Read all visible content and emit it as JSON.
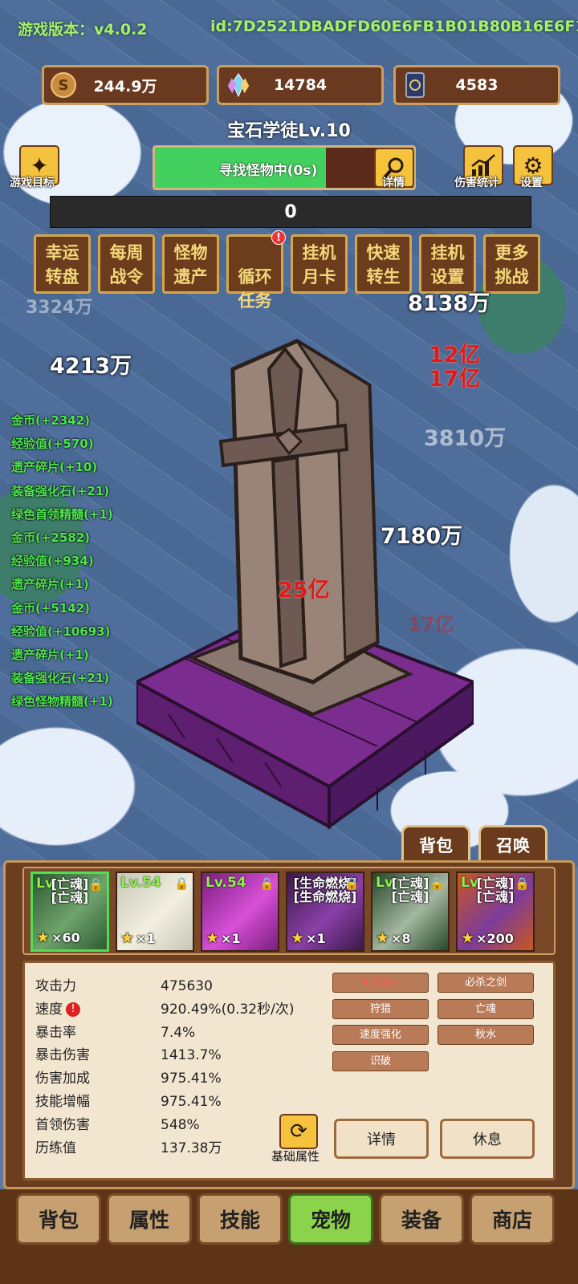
{
  "header": {
    "version_label": "游戏版本：v4.0.2",
    "player_id": "id:7D2521DBADFD60E6FB1B01B80B16E6F1"
  },
  "resources": [
    {
      "icon": "coin-icon",
      "value": "244.9万"
    },
    {
      "icon": "crystal-icon",
      "value": "14784"
    },
    {
      "icon": "card-icon",
      "value": "4583"
    }
  ],
  "player_title": "宝石学徒Lv.10",
  "search": {
    "status": "寻找怪物中(0s)",
    "progress": 0.66,
    "detail_label": "详情"
  },
  "left_tools": {
    "goals_label": "游戏目标"
  },
  "right_tools": {
    "damage_stats_label": "伤害统计",
    "settings_label": "设置"
  },
  "score_value": "0",
  "menu": [
    {
      "label": "幸运\n转盘",
      "badge": false
    },
    {
      "label": "每周\n战令",
      "badge": false
    },
    {
      "label": "怪物\n遗产",
      "badge": false
    },
    {
      "label": "循环\n任务",
      "badge": true
    },
    {
      "label": "挂机\n月卡",
      "badge": false
    },
    {
      "label": "快速\n转生",
      "badge": false
    },
    {
      "label": "挂机\n设置",
      "badge": false
    },
    {
      "label": "更多\n挑战",
      "badge": false
    }
  ],
  "damage_numbers": {
    "d1": "8138万",
    "d2": "4213万",
    "d3": "12亿",
    "d4": "17亿",
    "d5": "3810万",
    "d6": "7180万",
    "d7": "25亿",
    "d8": "17亿"
  },
  "loot_log": [
    "金币(+2342)",
    "经验值(+570)",
    "遗产碎片(+10)",
    "装备强化石(+21)",
    "绿色首领精髓(+1)",
    "金币(+2582)",
    "经验值(+934)",
    "遗产碎片(+1)",
    "金币(+5142)",
    "经验值(+10693)",
    "遗产碎片(+1)",
    "装备强化石(+21)",
    "绿色怪物精髓(+1)"
  ],
  "panel_tabs": {
    "bag": "背包",
    "summon": "召唤"
  },
  "pets": [
    {
      "lv": "Lv",
      "text": "[亡魂]\n[亡魂]",
      "count": "×60",
      "selected": true,
      "colors": [
        "#2e5a32",
        "#6ea36a"
      ]
    },
    {
      "lv": "Lv.54",
      "text": "",
      "count": "×1",
      "selected": false,
      "colors": [
        "#c7c7b8",
        "#f2efe0"
      ]
    },
    {
      "lv": "Lv.54",
      "text": "",
      "count": "×1",
      "selected": false,
      "colors": [
        "#7a1e7e",
        "#d84fd8"
      ]
    },
    {
      "lv": "",
      "text": "[生命燃烧]\n[生命燃烧]",
      "count": "×1",
      "selected": false,
      "colors": [
        "#3a1a48",
        "#8b3fa8"
      ]
    },
    {
      "lv": "Lv",
      "text": "[亡魂]\n[亡魂]",
      "count": "×8",
      "selected": false,
      "colors": [
        "#26472a",
        "#a4b7a0"
      ]
    },
    {
      "lv": "Lv",
      "text": "[亡魂]\n[亡魂]",
      "count": "×200",
      "selected": false,
      "colors": [
        "#c9571e",
        "#7d3c9a"
      ]
    }
  ],
  "stats": [
    {
      "label": "攻击力",
      "value": "475630",
      "warn": false
    },
    {
      "label": "速度",
      "value": "920.49%(0.32秒/次)",
      "warn": true
    },
    {
      "label": "暴击率",
      "value": "7.4%",
      "warn": false
    },
    {
      "label": "暴击伤害",
      "value": "1413.7%",
      "warn": false
    },
    {
      "label": "伤害加成",
      "value": "975.41%",
      "warn": false
    },
    {
      "label": "技能增幅",
      "value": "975.41%",
      "warn": false
    },
    {
      "label": "首领伤害",
      "value": "548%",
      "warn": false
    },
    {
      "label": "历练值",
      "value": "137.38万",
      "warn": false
    }
  ],
  "skills": [
    {
      "label": "※武魂+",
      "highlight": true
    },
    {
      "label": "必杀之剑",
      "highlight": false
    },
    {
      "label": "狩猎",
      "highlight": false
    },
    {
      "label": "亡魂",
      "highlight": false
    },
    {
      "label": "速度强化",
      "highlight": false
    },
    {
      "label": "秋水",
      "highlight": false
    },
    {
      "label": "识破",
      "highlight": false
    }
  ],
  "base_attr_label": "基础属性",
  "detail_button": "详情",
  "rest_button": "休息",
  "bottom_nav": [
    {
      "label": "背包",
      "active": false
    },
    {
      "label": "属性",
      "active": false
    },
    {
      "label": "技能",
      "active": false
    },
    {
      "label": "宠物",
      "active": true
    },
    {
      "label": "装备",
      "active": false
    },
    {
      "label": "商店",
      "active": false
    }
  ]
}
